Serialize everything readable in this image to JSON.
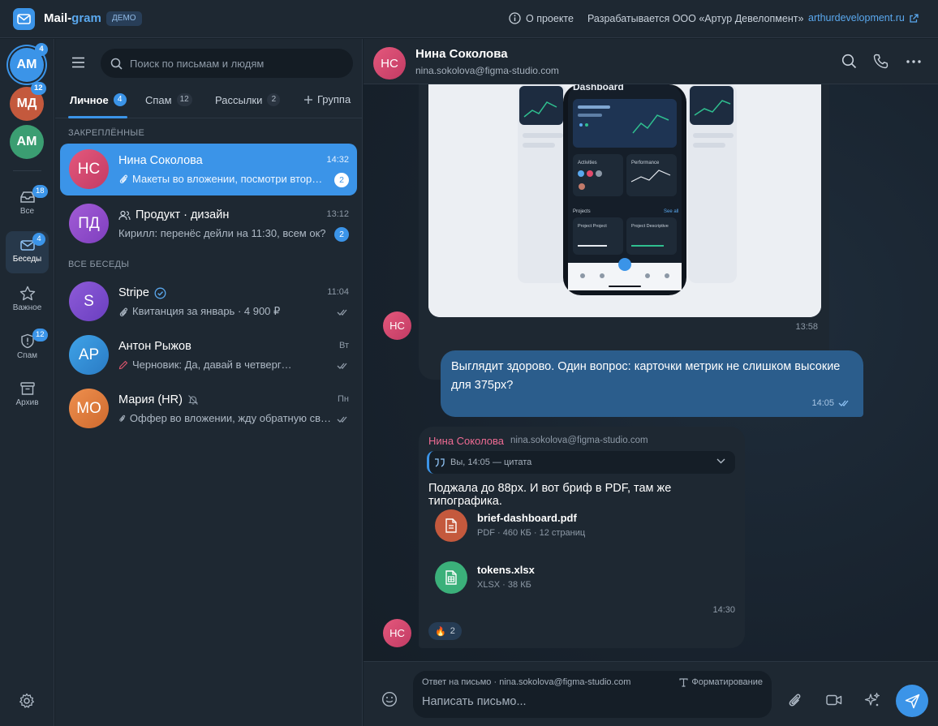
{
  "topbar": {
    "app_name_part1": "Mail-",
    "app_name_part2": "gram",
    "badge": "ДЕМО",
    "about": "О проекте",
    "developer": "Разрабатывается ООО «Артур Девелопмент»",
    "link": "arthurdevelopment.ru"
  },
  "rail": {
    "accounts": [
      {
        "initials": "АМ",
        "badge": "4",
        "color": "#3b94e8"
      },
      {
        "initials": "МД",
        "badge": "12",
        "color": "#c4593d"
      },
      {
        "initials": "АМ",
        "badge": "",
        "color": "#3b9e72"
      }
    ],
    "nav": [
      {
        "label": "Все",
        "badge": "18",
        "icon": "inbox-icon"
      },
      {
        "label": "Беседы",
        "badge": "4",
        "icon": "conversations-icon"
      },
      {
        "label": "Важное",
        "badge": "",
        "icon": "star-icon"
      },
      {
        "label": "Спам",
        "badge": "12",
        "icon": "shield-icon"
      },
      {
        "label": "Архив",
        "badge": "",
        "icon": "archive-icon"
      }
    ]
  },
  "list": {
    "search_placeholder": "Поиск по письмам и людям",
    "tabs": [
      {
        "label": "Личное",
        "count": "4"
      },
      {
        "label": "Спам",
        "count": "12"
      },
      {
        "label": "Рассылки",
        "count": "2"
      },
      {
        "label": "Группа"
      }
    ],
    "pinned_label": "ЗАКРЕПЛЁННЫЕ",
    "all_label": "ВСЕ БЕСЕДЫ",
    "chats": [
      {
        "initials": "НС",
        "name": "Нина Соколова",
        "time": "14:32",
        "preview": "Макеты во вложении, посмотри втор…",
        "unread": "2"
      },
      {
        "initials": "ПД",
        "name": "Продукт · дизайн",
        "time": "13:12",
        "preview": "Кирилл: перенёс дейли на 11:30, всем ок?",
        "unread": "2"
      },
      {
        "initials": "S",
        "name": "Stripe",
        "time": "11:04",
        "preview": "Квитанция за январь · 4 900 ₽"
      },
      {
        "initials": "АР",
        "name": "Антон Рыжов",
        "time": "Вт",
        "preview": "Черновик: Да, давай в четверг…"
      },
      {
        "initials": "МО",
        "name": "Мария (HR)",
        "time": "Пн",
        "preview": "Оффер во вложении, жду обратную св…"
      }
    ]
  },
  "conversation": {
    "initials": "НС",
    "name": "Нина Соколова",
    "email": "nina.sokolova@figma-studio.com",
    "image_message": {
      "time": "13:58",
      "preview_title": "Dashboard",
      "card_labels": [
        "Activities",
        "Performance",
        "Projects",
        "See all",
        "Project Project",
        "Project Descriptive"
      ]
    },
    "outgoing": {
      "text": "Выглядит здорово. Один вопрос: карточки метрик не слишком высокие для 375px?",
      "time": "14:05"
    },
    "incoming": {
      "sender": "Нина Соколова",
      "sender_email": "nina.sokolova@figma-studio.com",
      "quote": "Вы, 14:05 — цитата",
      "text": "Поджала до 88px. И вот бриф в PDF, там же типографика.",
      "files": [
        {
          "name": "brief-dashboard.pdf",
          "meta": "PDF · 460 КБ · 12 страниц",
          "color": "#c4593d"
        },
        {
          "name": "tokens.xlsx",
          "meta": "XLSX · 38 КБ",
          "color": "#3bb07a"
        }
      ],
      "time": "14:30",
      "reaction_emoji": "🔥",
      "reaction_count": "2"
    }
  },
  "composer": {
    "reply_to": "Ответ на письмо · nina.sokolova@figma-studio.com",
    "formatting": "Форматирование",
    "placeholder": "Написать письмо..."
  }
}
